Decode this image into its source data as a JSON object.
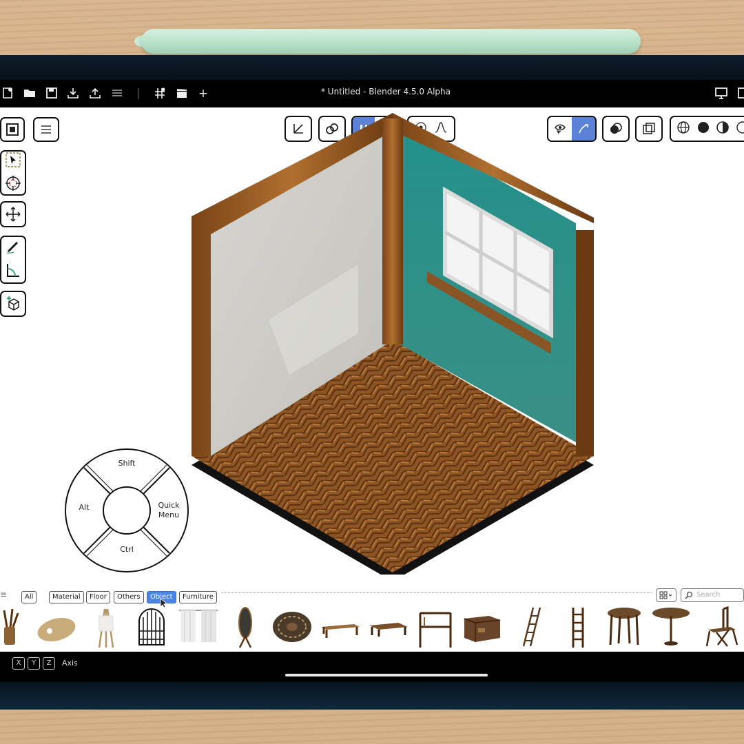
{
  "window": {
    "title": "* Untitled - Blender 4.5.0 Alpha"
  },
  "pie_menu": {
    "top": "Shift",
    "left": "Alt",
    "right_line1": "Quick",
    "right_line2": "Menu",
    "bottom": "Ctrl"
  },
  "asset_tabs": [
    {
      "label": "All"
    },
    {
      "label": "Material"
    },
    {
      "label": "Floor"
    },
    {
      "label": "Others"
    },
    {
      "label": "Object"
    },
    {
      "label": "Furniture"
    }
  ],
  "asset_tab_active": "Object",
  "search": {
    "placeholder": "Search"
  },
  "status": {
    "keys": [
      "X",
      "Y",
      "Z"
    ],
    "label": "Axis"
  },
  "colors": {
    "accent": "#5b82d6",
    "teal_wall": "#2d8c84",
    "wood": "#8b5a2b"
  },
  "assets": [
    "brush-jar",
    "palette",
    "easel",
    "bird-cage",
    "curtain",
    "standing-mirror",
    "round-rug",
    "bench",
    "coffee-table",
    "wooden-shelf-frame",
    "chest",
    "leaning-ladder",
    "standing-ladder",
    "round-stool",
    "round-table",
    "wooden-chair"
  ]
}
